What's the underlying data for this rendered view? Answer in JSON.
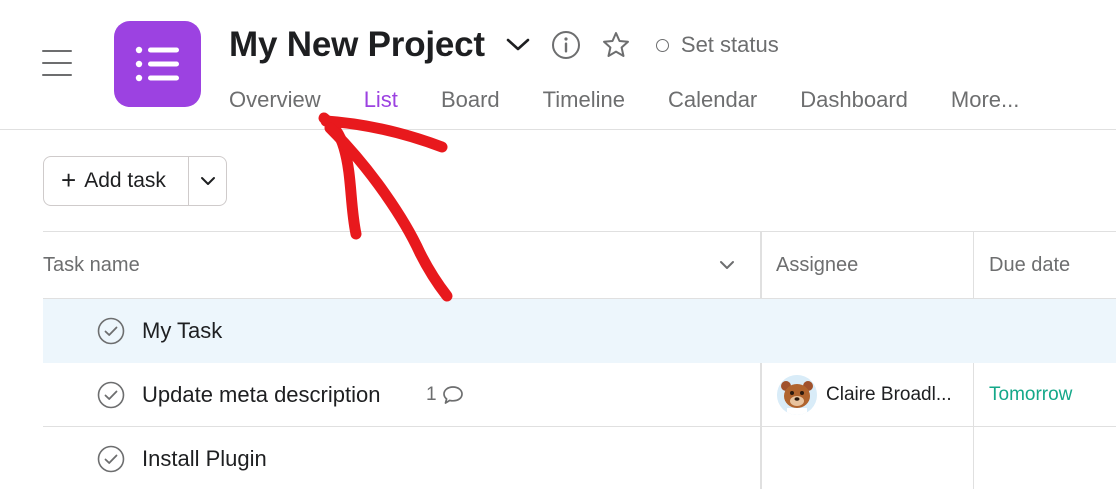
{
  "header": {
    "project_title": "My New Project",
    "set_status_label": "Set status",
    "icons": [
      "menu-icon",
      "list-icon",
      "chevron-down-icon",
      "info-icon",
      "star-icon",
      "status-circle-icon"
    ]
  },
  "tabs": [
    {
      "label": "Overview",
      "active": false
    },
    {
      "label": "List",
      "active": true
    },
    {
      "label": "Board",
      "active": false
    },
    {
      "label": "Timeline",
      "active": false
    },
    {
      "label": "Calendar",
      "active": false
    },
    {
      "label": "Dashboard",
      "active": false
    },
    {
      "label": "More...",
      "active": false
    }
  ],
  "toolbar": {
    "add_task_label": "Add task"
  },
  "table": {
    "columns": {
      "task_name": "Task name",
      "assignee": "Assignee",
      "due_date": "Due date"
    },
    "rows": [
      {
        "name": "My Task",
        "comments": "",
        "assignee": "",
        "due": "",
        "selected": true
      },
      {
        "name": "Update meta description",
        "comments": "1",
        "assignee": "Claire Broadl...",
        "due": "Tomorrow",
        "selected": false
      },
      {
        "name": "Install Plugin",
        "comments": "",
        "assignee": "",
        "due": "",
        "selected": false
      }
    ]
  },
  "colors": {
    "accent": "#9c42e1",
    "due_tomorrow": "#14a889",
    "selected_row": "#edf6fc",
    "annotation_arrow": "#e8191d"
  }
}
